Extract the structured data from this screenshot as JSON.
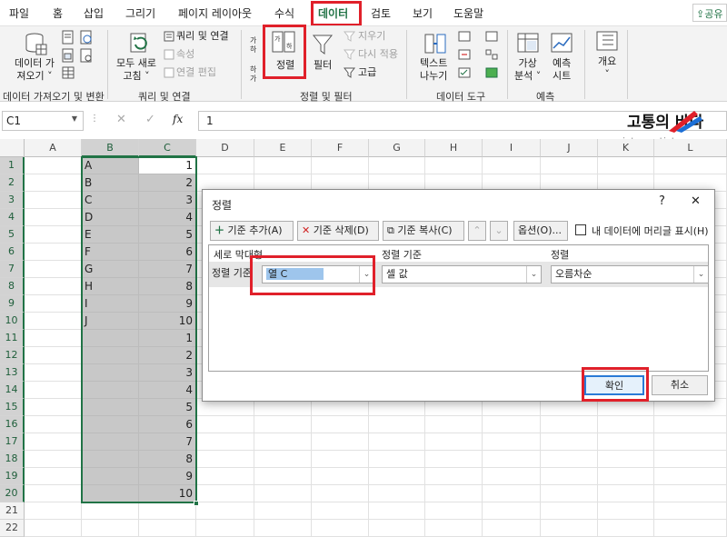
{
  "tabs": [
    "파일",
    "홈",
    "삽입",
    "그리기",
    "페이지 레이아웃",
    "수식",
    "데이터",
    "검토",
    "보기",
    "도움말"
  ],
  "active_tab": "데이터",
  "share_label": "공유",
  "ribbon": {
    "get_data": "데이터 가\n져오기 ˅",
    "refresh_all": "모두 새로\n고침 ˅",
    "queries_connections": "쿼리 및 연결",
    "properties": "속성",
    "edit_links": "연결 편집",
    "sort": "정렬",
    "filter": "필터",
    "clear": "지우기",
    "reapply": "다시 적용",
    "advanced": "고급",
    "text_to_columns": "텍스트\n나누기",
    "what_if": "가상\n분석 ˅",
    "forecast_sheet": "예측\n시트",
    "outline": "개요\n˅",
    "groups": {
      "get_transform": "데이터 가져오기 및 변환",
      "queries": "쿼리 및 연결",
      "sort_filter": "정렬 및 필터",
      "data_tools": "데이터 도구",
      "forecast": "예측"
    }
  },
  "formula_bar": {
    "name_box": "C1",
    "fx": "fx",
    "value": "1"
  },
  "watermark": {
    "title": "고통의 바다",
    "url": "pictures.tistory.com"
  },
  "columns": [
    "A",
    "B",
    "C",
    "D",
    "E",
    "F",
    "G",
    "H",
    "I",
    "J",
    "K",
    "L"
  ],
  "rows": [
    "1",
    "2",
    "3",
    "4",
    "5",
    "6",
    "7",
    "8",
    "9",
    "10",
    "11",
    "12",
    "13",
    "14",
    "15",
    "16",
    "17",
    "18",
    "19",
    "20",
    "21",
    "22"
  ],
  "col_b": [
    "A",
    "B",
    "C",
    "D",
    "E",
    "F",
    "G",
    "H",
    "I",
    "J",
    "",
    "",
    "",
    "",
    "",
    "",
    "",
    "",
    "",
    ""
  ],
  "col_c": [
    "1",
    "2",
    "3",
    "4",
    "5",
    "6",
    "7",
    "8",
    "9",
    "10",
    "1",
    "2",
    "3",
    "4",
    "5",
    "6",
    "7",
    "8",
    "9",
    "10"
  ],
  "dialog": {
    "title": "정렬",
    "help": "?",
    "close": "✕",
    "add_level": "기준 추가(A)",
    "delete_level": "기준 삭제(D)",
    "copy_level": "기준 복사(C)",
    "options": "옵션(O)...",
    "header_checkbox": "내 데이터에 머리글 표시(H)",
    "header_column": "세로 막대형",
    "header_sort_on": "정렬 기준",
    "header_order": "정렬",
    "row_label": "정렬 기준",
    "column_value": "열 C",
    "sort_on_value": "셀 값",
    "order_value": "오름차순",
    "ok": "확인",
    "cancel": "취소"
  }
}
